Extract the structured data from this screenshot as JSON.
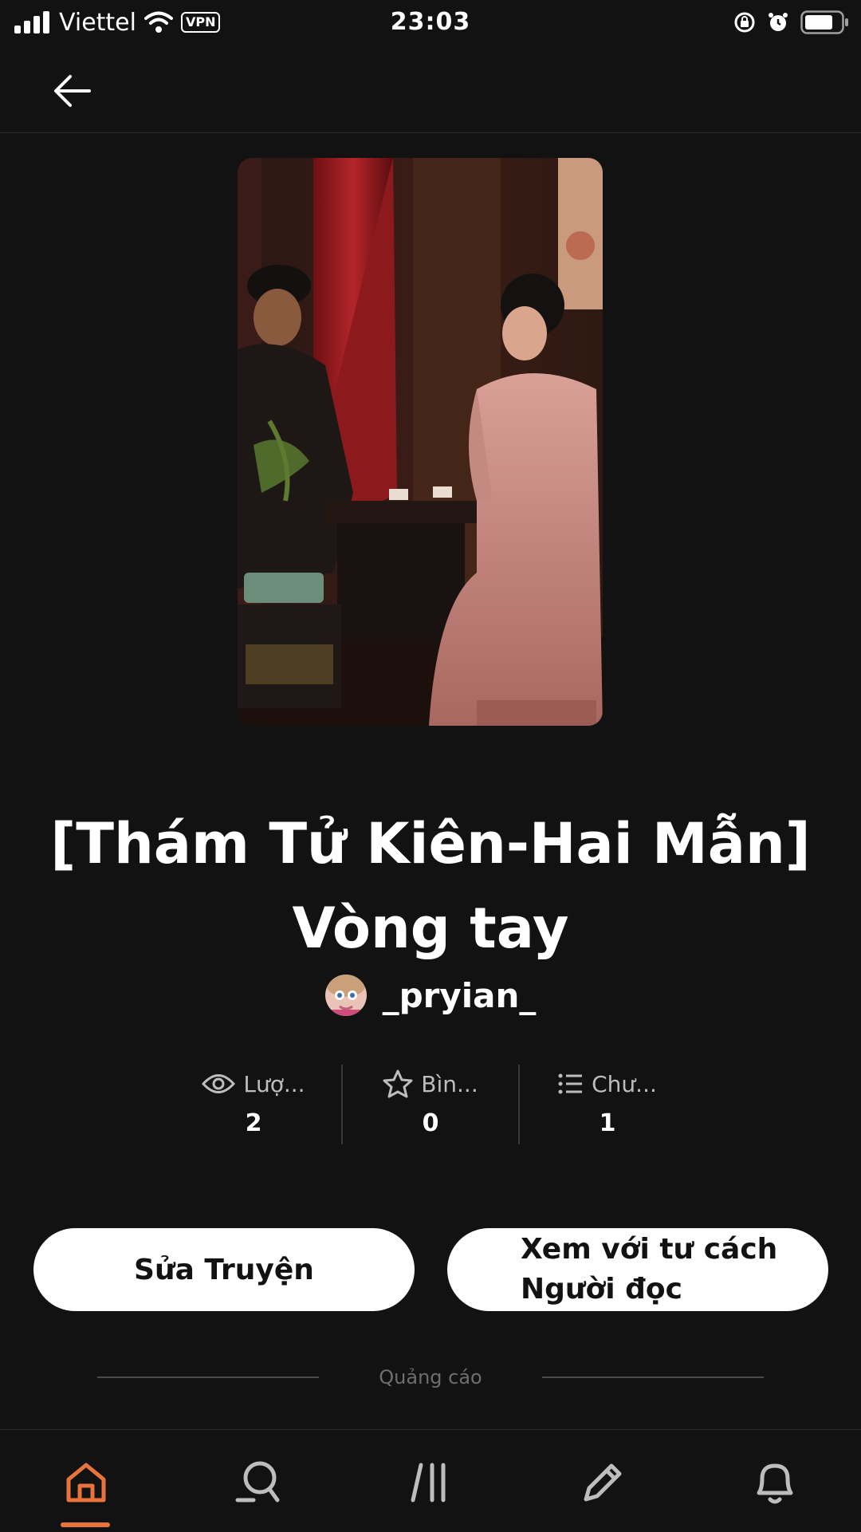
{
  "status_bar": {
    "carrier": "Viettel",
    "vpn": "VPN",
    "time": "23:03"
  },
  "story": {
    "title": "[Thám Tử Kiên-Hai Mẫn] Vòng tay",
    "author": "_pryian_"
  },
  "stats": [
    {
      "icon": "eye-icon",
      "label": "Lượ...",
      "value": "2"
    },
    {
      "icon": "star-icon",
      "label": "Bìn...",
      "value": "0"
    },
    {
      "icon": "list-icon",
      "label": "Chư...",
      "value": "1"
    }
  ],
  "buttons": {
    "edit_label": "Sửa Truyện",
    "view_label_line1": "Xem với tư cách",
    "view_label_line2": "Người đọc"
  },
  "ad_label": "Quảng cáo",
  "colors": {
    "background": "#121212",
    "accent": "#e8733d",
    "button_bg": "#ffffff"
  },
  "nav": {
    "items": [
      "home-icon",
      "search-icon",
      "library-icon",
      "write-icon",
      "bell-icon"
    ],
    "active": "home-icon"
  }
}
